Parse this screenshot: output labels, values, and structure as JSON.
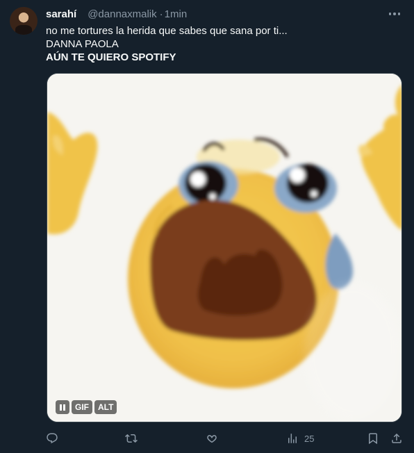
{
  "author": {
    "name": "sarahí",
    "handle": "@dannaxmalik",
    "separator": "·",
    "time": "1min"
  },
  "tweet": {
    "line1": "no me tortures la herida que sabes que sana por ti...",
    "line2": "DANNA PAOLA",
    "line3": "AÚN TE QUIERO SPOTIFY"
  },
  "media": {
    "type": "gif",
    "description_icon": "crying-emoji",
    "badges": {
      "gif": "GIF",
      "alt": "ALT"
    }
  },
  "actions": {
    "views_count": "25"
  },
  "colors": {
    "background": "#15202b",
    "text": "#f7f9f9",
    "muted": "#8b98a5"
  }
}
